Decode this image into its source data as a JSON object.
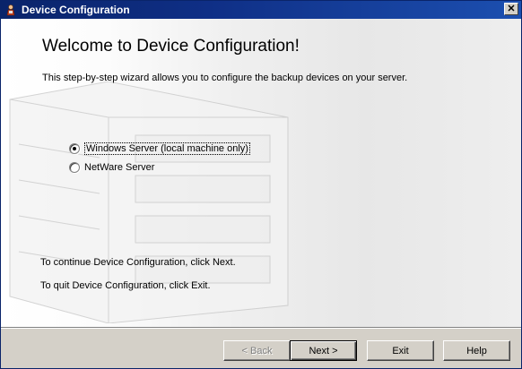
{
  "window": {
    "title": "Device Configuration",
    "close_label": "✕"
  },
  "content": {
    "heading": "Welcome to Device Configuration!",
    "intro": "This step-by-step wizard allows you to configure the backup devices on your server.",
    "options": [
      {
        "label": "Windows Server (local machine only)",
        "selected": true
      },
      {
        "label": "NetWare Server",
        "selected": false
      }
    ],
    "note_continue": "To continue Device Configuration, click Next.",
    "note_quit": "To quit Device Configuration, click Exit."
  },
  "buttons": {
    "back": "< Back",
    "next": "Next >",
    "exit": "Exit",
    "help": "Help"
  },
  "colors": {
    "titlebar_start": "#0a246a",
    "titlebar_end": "#1c4fb0",
    "dialog_face": "#d4d0c8"
  }
}
